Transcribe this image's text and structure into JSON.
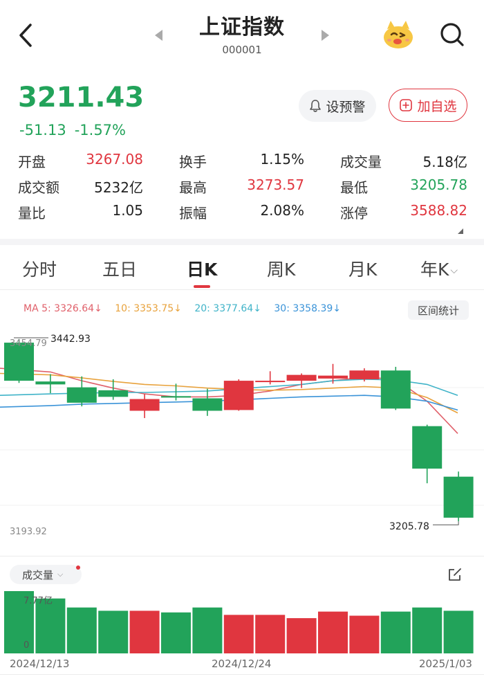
{
  "header": {
    "title": "上证指数",
    "code": "000001"
  },
  "quote": {
    "price": "3211.43",
    "change": "-51.13",
    "change_pct": "-1.57%",
    "alert_label": "设预警",
    "favorite_label": "加自选"
  },
  "stats": [
    [
      {
        "label": "开盘",
        "value": "3267.08",
        "tone": "red"
      },
      {
        "label": "换手",
        "value": "1.15%",
        "tone": ""
      },
      {
        "label": "成交量",
        "value": "5.18亿",
        "tone": ""
      }
    ],
    [
      {
        "label": "成交额",
        "value": "5232亿",
        "tone": ""
      },
      {
        "label": "最高",
        "value": "3273.57",
        "tone": "red"
      },
      {
        "label": "最低",
        "value": "3205.78",
        "tone": "green"
      }
    ],
    [
      {
        "label": "量比",
        "value": "1.05",
        "tone": ""
      },
      {
        "label": "振幅",
        "value": "2.08%",
        "tone": ""
      },
      {
        "label": "涨停",
        "value": "3588.82",
        "tone": "red"
      }
    ]
  ],
  "tabs": [
    "分时",
    "五日",
    "日K",
    "周K",
    "月K",
    "年K"
  ],
  "active_tab": "日K",
  "ma_legend": [
    {
      "text": "MA 5: 3326.64↓",
      "color": "#e0606a"
    },
    {
      "text": "10: 3353.75↓",
      "color": "#e8a23c"
    },
    {
      "text": "20: 3377.64↓",
      "color": "#3fb3c8"
    },
    {
      "text": "30: 3358.39↓",
      "color": "#3a93d8"
    }
  ],
  "range_stat_label": "区间统计",
  "volume_label": "成交量",
  "colors": {
    "up": "#e0363f",
    "down": "#22a35a",
    "ma5": "#e0606a",
    "ma10": "#e8a23c",
    "ma20": "#3fb3c8",
    "ma30": "#3a93d8"
  },
  "chart_data": {
    "type": "candlestick",
    "price_axis": {
      "max_label": "3454.79",
      "min_label": "3193.92",
      "ylim": [
        3193.92,
        3454.79
      ]
    },
    "high_annotation": "3442.93",
    "low_annotation": "3205.78",
    "candles": [
      {
        "o": 3450,
        "c": 3398,
        "h": 3455,
        "l": 3395
      },
      {
        "o": 3397,
        "c": 3393,
        "h": 3407,
        "l": 3381
      },
      {
        "o": 3389,
        "c": 3368,
        "h": 3404,
        "l": 3363
      },
      {
        "o": 3385,
        "c": 3376,
        "h": 3400,
        "l": 3372
      },
      {
        "o": 3357,
        "c": 3373,
        "h": 3380,
        "l": 3347
      },
      {
        "o": 3377,
        "c": 3375,
        "h": 3394,
        "l": 3371
      },
      {
        "o": 3374,
        "c": 3357,
        "h": 3387,
        "l": 3350
      },
      {
        "o": 3358,
        "c": 3398,
        "h": 3400,
        "l": 3357
      },
      {
        "o": 3398,
        "c": 3398,
        "h": 3411,
        "l": 3393
      },
      {
        "o": 3398,
        "c": 3406,
        "h": 3408,
        "l": 3388
      },
      {
        "o": 3401,
        "c": 3405,
        "h": 3421,
        "l": 3394
      },
      {
        "o": 3400,
        "c": 3412,
        "h": 3415,
        "l": 3397
      },
      {
        "o": 3412,
        "c": 3360,
        "h": 3417,
        "l": 3358
      },
      {
        "o": 3336,
        "c": 3278,
        "h": 3338,
        "l": 3258
      },
      {
        "o": 3267,
        "c": 3211,
        "h": 3274,
        "l": 3206
      }
    ],
    "ma5": [
      3415,
      3410,
      3398,
      3388,
      3380,
      3376,
      3376,
      3378,
      3384,
      3393,
      3398,
      3403,
      3400,
      3370,
      3326
    ],
    "ma10": [
      3408,
      3406,
      3402,
      3397,
      3393,
      3391,
      3388,
      3386,
      3385,
      3386,
      3388,
      3390,
      3388,
      3375,
      3354
    ],
    "ma20": [
      3378,
      3380,
      3381,
      3382,
      3382,
      3383,
      3384,
      3387,
      3390,
      3393,
      3398,
      3400,
      3399,
      3393,
      3378
    ],
    "ma30": [
      3362,
      3364,
      3366,
      3367,
      3368,
      3369,
      3370,
      3372,
      3374,
      3376,
      3377,
      3378,
      3376,
      3370,
      3358
    ],
    "volume_axis": {
      "max_label": "7.77亿",
      "min_label": "0",
      "ylim": [
        0,
        7.77
      ]
    },
    "volume": [
      7.6,
      6.7,
      5.6,
      5.2,
      5.2,
      5.0,
      5.6,
      4.7,
      4.7,
      4.3,
      5.1,
      4.6,
      5.1,
      5.6,
      5.2
    ],
    "dates": {
      "start": "2024/12/13",
      "mid": "2024/12/24",
      "end": "2025/1/03"
    }
  }
}
